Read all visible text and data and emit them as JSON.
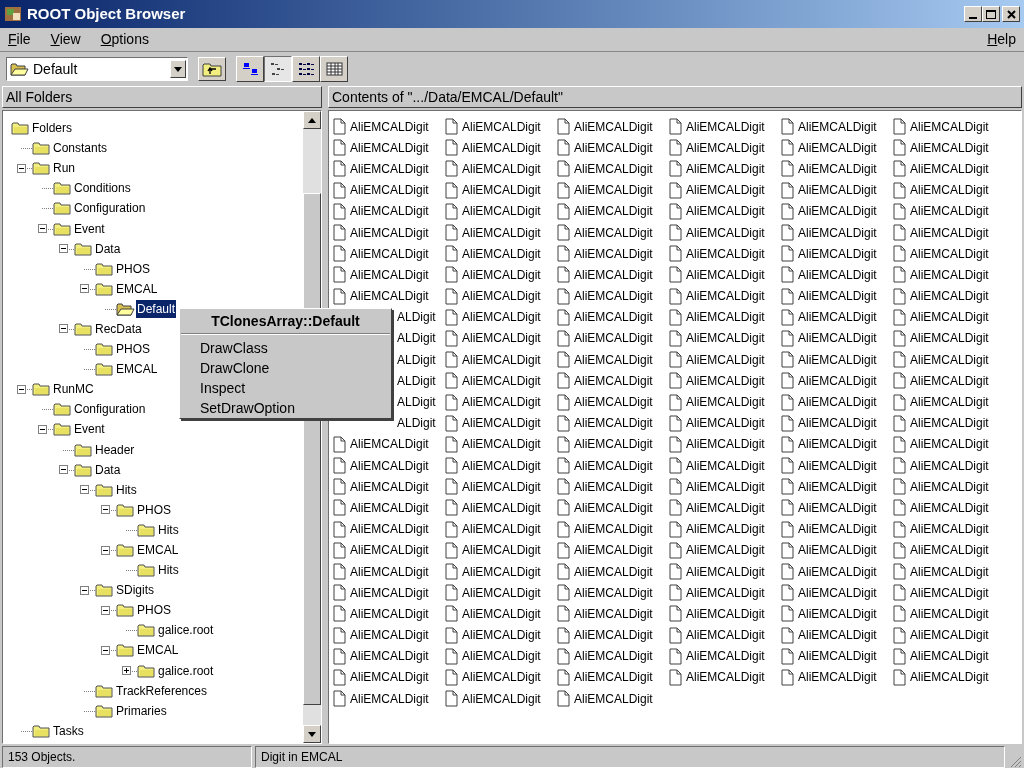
{
  "window": {
    "title": "ROOT Object Browser"
  },
  "menus": [
    {
      "label": "File"
    },
    {
      "label": "View"
    },
    {
      "label": "Options"
    }
  ],
  "help_menu": {
    "label": "Help"
  },
  "toolbar": {
    "location": "Default",
    "view_buttons": [
      {
        "kind": "large",
        "selected": false
      },
      {
        "kind": "list",
        "selected": true
      },
      {
        "kind": "small",
        "selected": false
      },
      {
        "kind": "details",
        "selected": false
      }
    ]
  },
  "left_pane": {
    "header": "All Folders",
    "tree": [
      {
        "label": "Folders",
        "selected": false,
        "children": [
          {
            "label": "Constants",
            "selected": false
          },
          {
            "label": "Run",
            "selected": false,
            "expanded": true,
            "children": [
              {
                "label": "Conditions",
                "selected": false
              },
              {
                "label": "Configuration",
                "selected": false
              },
              {
                "label": "Event",
                "selected": false,
                "expanded": true,
                "children": [
                  {
                    "label": "Data",
                    "selected": false,
                    "expanded": true,
                    "children": [
                      {
                        "label": "PHOS",
                        "selected": false
                      },
                      {
                        "label": "EMCAL",
                        "selected": false,
                        "expanded": true,
                        "children": [
                          {
                            "label": "Default",
                            "selected": true
                          }
                        ]
                      }
                    ]
                  },
                  {
                    "label": "RecData",
                    "selected": false,
                    "expanded": true,
                    "children": [
                      {
                        "label": "PHOS",
                        "selected": false
                      },
                      {
                        "label": "EMCAL",
                        "selected": false
                      }
                    ]
                  }
                ]
              }
            ]
          },
          {
            "label": "RunMC",
            "selected": false,
            "expanded": true,
            "children": [
              {
                "label": "Configuration",
                "selected": false
              },
              {
                "label": "Event",
                "selected": false,
                "expanded": true,
                "children": [
                  {
                    "label": "Header",
                    "selected": false
                  },
                  {
                    "label": "Data",
                    "selected": false,
                    "expanded": true,
                    "children": [
                      {
                        "label": "Hits",
                        "selected": false,
                        "expanded": true,
                        "children": [
                          {
                            "label": "PHOS",
                            "selected": false,
                            "expanded": true,
                            "children": [
                              {
                                "label": "Hits",
                                "selected": false
                              }
                            ]
                          },
                          {
                            "label": "EMCAL",
                            "selected": false,
                            "expanded": true,
                            "children": [
                              {
                                "label": "Hits",
                                "selected": false
                              }
                            ]
                          }
                        ]
                      },
                      {
                        "label": "SDigits",
                        "selected": false,
                        "expanded": true,
                        "children": [
                          {
                            "label": "PHOS",
                            "selected": false,
                            "expanded": true,
                            "children": [
                              {
                                "label": "galice.root",
                                "selected": false
                              }
                            ]
                          },
                          {
                            "label": "EMCAL",
                            "selected": false,
                            "expanded": true,
                            "children": [
                              {
                                "label": "galice.root",
                                "selected": false,
                                "expanded": false
                              }
                            ]
                          }
                        ]
                      },
                      {
                        "label": "TrackReferences",
                        "selected": false
                      },
                      {
                        "label": "Primaries",
                        "selected": false
                      }
                    ]
                  }
                ]
              }
            ]
          },
          {
            "label": "Tasks",
            "selected": false
          }
        ]
      }
    ]
  },
  "right_pane": {
    "header": "Contents of \".../Data/EMCAL/Default\"",
    "items": [
      {
        "kind": "file",
        "label": "AliEMCALDigit"
      },
      {
        "kind": "file",
        "label": "AliEMCALDigit"
      },
      {
        "kind": "file",
        "label": "AliEMCALDigit"
      },
      {
        "kind": "file",
        "label": "AliEMCALDigit"
      },
      {
        "kind": "file",
        "label": "AliEMCALDigit"
      },
      {
        "kind": "file",
        "label": "AliEMCALDigit"
      },
      {
        "kind": "file",
        "label": "AliEMCALDigit"
      },
      {
        "kind": "file",
        "label": "AliEMCALDigit"
      },
      {
        "kind": "file",
        "label": "AliEMCALDigit"
      },
      {
        "kind": "file",
        "label": "AliEMCALDigit"
      },
      {
        "kind": "file",
        "label": "AliEMCALDigit"
      },
      {
        "kind": "file",
        "label": "AliEMCALDigit"
      },
      {
        "kind": "file",
        "label": "AliEMCALDigit"
      },
      {
        "kind": "file",
        "label": "AliEMCALDigit"
      },
      {
        "kind": "file",
        "label": "AliEMCALDigit"
      },
      {
        "kind": "file",
        "label": "AliEMCALDigit"
      },
      {
        "kind": "file",
        "label": "AliEMCALDigit"
      },
      {
        "kind": "file",
        "label": "AliEMCALDigit"
      },
      {
        "kind": "file",
        "label": "AliEMCALDigit"
      },
      {
        "kind": "file",
        "label": "AliEMCALDigit"
      },
      {
        "kind": "file",
        "label": "AliEMCALDigit"
      },
      {
        "kind": "file",
        "label": "AliEMCALDigit"
      },
      {
        "kind": "file",
        "label": "AliEMCALDigit"
      },
      {
        "kind": "file",
        "label": "AliEMCALDigit"
      },
      {
        "kind": "file",
        "label": "AliEMCALDigit"
      },
      {
        "kind": "file",
        "label": "AliEMCALDigit"
      },
      {
        "kind": "file",
        "label": "AliEMCALDigit"
      },
      {
        "kind": "file",
        "label": "AliEMCALDigit"
      },
      {
        "kind": "file",
        "label": "AliEMCALDigit"
      },
      {
        "kind": "file",
        "label": "AliEMCALDigit"
      },
      {
        "kind": "file",
        "label": "AliEMCALDigit"
      },
      {
        "kind": "file",
        "label": "AliEMCALDigit"
      },
      {
        "kind": "file",
        "label": "AliEMCALDigit"
      },
      {
        "kind": "file",
        "label": "AliEMCALDigit"
      },
      {
        "kind": "file",
        "label": "AliEMCALDigit"
      },
      {
        "kind": "file",
        "label": "AliEMCALDigit"
      },
      {
        "kind": "file",
        "label": "AliEMCALDigit"
      },
      {
        "kind": "file",
        "label": "AliEMCALDigit"
      },
      {
        "kind": "file",
        "label": "AliEMCALDigit"
      },
      {
        "kind": "file",
        "label": "AliEMCALDigit"
      },
      {
        "kind": "file",
        "label": "AliEMCALDigit"
      },
      {
        "kind": "file",
        "label": "AliEMCALDigit"
      },
      {
        "kind": "file",
        "label": "AliEMCALDigit"
      },
      {
        "kind": "file",
        "label": "AliEMCALDigit"
      },
      {
        "kind": "file",
        "label": "AliEMCALDigit"
      },
      {
        "kind": "file",
        "label": "AliEMCALDigit"
      },
      {
        "kind": "file",
        "label": "AliEMCALDigit"
      },
      {
        "kind": "file",
        "label": "AliEMCALDigit"
      },
      {
        "kind": "file",
        "label": "AliEMCALDigit"
      },
      {
        "kind": "file",
        "label": "AliEMCALDigit"
      },
      {
        "kind": "file",
        "label": "AliEMCALDigit"
      },
      {
        "kind": "file",
        "label": "AliEMCALDigit"
      },
      {
        "kind": "file",
        "label": "AliEMCALDigit"
      },
      {
        "kind": "file",
        "label": "AliEMCALDigit"
      },
      {
        "kind": "covered",
        "label": "ALDigit"
      },
      {
        "kind": "file",
        "label": "AliEMCALDigit"
      },
      {
        "kind": "file",
        "label": "AliEMCALDigit"
      },
      {
        "kind": "file",
        "label": "AliEMCALDigit"
      },
      {
        "kind": "file",
        "label": "AliEMCALDigit"
      },
      {
        "kind": "file",
        "label": "AliEMCALDigit"
      },
      {
        "kind": "covered",
        "label": "ALDigit"
      },
      {
        "kind": "file",
        "label": "AliEMCALDigit"
      },
      {
        "kind": "file",
        "label": "AliEMCALDigit"
      },
      {
        "kind": "file",
        "label": "AliEMCALDigit"
      },
      {
        "kind": "file",
        "label": "AliEMCALDigit"
      },
      {
        "kind": "file",
        "label": "AliEMCALDigit"
      },
      {
        "kind": "covered",
        "label": "ALDigit"
      },
      {
        "kind": "file",
        "label": "AliEMCALDigit"
      },
      {
        "kind": "file",
        "label": "AliEMCALDigit"
      },
      {
        "kind": "file",
        "label": "AliEMCALDigit"
      },
      {
        "kind": "file",
        "label": "AliEMCALDigit"
      },
      {
        "kind": "file",
        "label": "AliEMCALDigit"
      },
      {
        "kind": "covered",
        "label": "ALDigit"
      },
      {
        "kind": "file",
        "label": "AliEMCALDigit"
      },
      {
        "kind": "file",
        "label": "AliEMCALDigit"
      },
      {
        "kind": "file",
        "label": "AliEMCALDigit"
      },
      {
        "kind": "file",
        "label": "AliEMCALDigit"
      },
      {
        "kind": "file",
        "label": "AliEMCALDigit"
      },
      {
        "kind": "covered",
        "label": "ALDigit"
      },
      {
        "kind": "file",
        "label": "AliEMCALDigit"
      },
      {
        "kind": "file",
        "label": "AliEMCALDigit"
      },
      {
        "kind": "file",
        "label": "AliEMCALDigit"
      },
      {
        "kind": "file",
        "label": "AliEMCALDigit"
      },
      {
        "kind": "file",
        "label": "AliEMCALDigit"
      },
      {
        "kind": "covered",
        "label": "ALDigit"
      },
      {
        "kind": "file",
        "label": "AliEMCALDigit"
      },
      {
        "kind": "file",
        "label": "AliEMCALDigit"
      },
      {
        "kind": "file",
        "label": "AliEMCALDigit"
      },
      {
        "kind": "file",
        "label": "AliEMCALDigit"
      },
      {
        "kind": "file",
        "label": "AliEMCALDigit"
      },
      {
        "kind": "file",
        "label": "AliEMCALDigit"
      },
      {
        "kind": "file",
        "label": "AliEMCALDigit"
      },
      {
        "kind": "file",
        "label": "AliEMCALDigit"
      },
      {
        "kind": "file",
        "label": "AliEMCALDigit"
      },
      {
        "kind": "file",
        "label": "AliEMCALDigit"
      },
      {
        "kind": "file",
        "label": "AliEMCALDigit"
      },
      {
        "kind": "file",
        "label": "AliEMCALDigit"
      },
      {
        "kind": "file",
        "label": "AliEMCALDigit"
      },
      {
        "kind": "file",
        "label": "AliEMCALDigit"
      },
      {
        "kind": "file",
        "label": "AliEMCALDigit"
      },
      {
        "kind": "file",
        "label": "AliEMCALDigit"
      },
      {
        "kind": "file",
        "label": "AliEMCALDigit"
      },
      {
        "kind": "file",
        "label": "AliEMCALDigit"
      },
      {
        "kind": "file",
        "label": "AliEMCALDigit"
      },
      {
        "kind": "file",
        "label": "AliEMCALDigit"
      },
      {
        "kind": "file",
        "label": "AliEMCALDigit"
      },
      {
        "kind": "file",
        "label": "AliEMCALDigit"
      },
      {
        "kind": "file",
        "label": "AliEMCALDigit"
      },
      {
        "kind": "file",
        "label": "AliEMCALDigit"
      },
      {
        "kind": "file",
        "label": "AliEMCALDigit"
      },
      {
        "kind": "file",
        "label": "AliEMCALDigit"
      },
      {
        "kind": "file",
        "label": "AliEMCALDigit"
      },
      {
        "kind": "file",
        "label": "AliEMCALDigit"
      },
      {
        "kind": "file",
        "label": "AliEMCALDigit"
      },
      {
        "kind": "file",
        "label": "AliEMCALDigit"
      },
      {
        "kind": "file",
        "label": "AliEMCALDigit"
      },
      {
        "kind": "file",
        "label": "AliEMCALDigit"
      },
      {
        "kind": "file",
        "label": "AliEMCALDigit"
      },
      {
        "kind": "file",
        "label": "AliEMCALDigit"
      },
      {
        "kind": "file",
        "label": "AliEMCALDigit"
      },
      {
        "kind": "file",
        "label": "AliEMCALDigit"
      },
      {
        "kind": "file",
        "label": "AliEMCALDigit"
      },
      {
        "kind": "file",
        "label": "AliEMCALDigit"
      },
      {
        "kind": "file",
        "label": "AliEMCALDigit"
      },
      {
        "kind": "file",
        "label": "AliEMCALDigit"
      },
      {
        "kind": "file",
        "label": "AliEMCALDigit"
      },
      {
        "kind": "file",
        "label": "AliEMCALDigit"
      },
      {
        "kind": "file",
        "label": "AliEMCALDigit"
      },
      {
        "kind": "file",
        "label": "AliEMCALDigit"
      },
      {
        "kind": "file",
        "label": "AliEMCALDigit"
      },
      {
        "kind": "file",
        "label": "AliEMCALDigit"
      },
      {
        "kind": "file",
        "label": "AliEMCALDigit"
      },
      {
        "kind": "file",
        "label": "AliEMCALDigit"
      },
      {
        "kind": "file",
        "label": "AliEMCALDigit"
      },
      {
        "kind": "file",
        "label": "AliEMCALDigit"
      },
      {
        "kind": "file",
        "label": "AliEMCALDigit"
      },
      {
        "kind": "file",
        "label": "AliEMCALDigit"
      },
      {
        "kind": "file",
        "label": "AliEMCALDigit"
      },
      {
        "kind": "file",
        "label": "AliEMCALDigit"
      },
      {
        "kind": "file",
        "label": "AliEMCALDigit"
      },
      {
        "kind": "file",
        "label": "AliEMCALDigit"
      },
      {
        "kind": "file",
        "label": "AliEMCALDigit"
      },
      {
        "kind": "file",
        "label": "AliEMCALDigit"
      },
      {
        "kind": "file",
        "label": "AliEMCALDigit"
      },
      {
        "kind": "file",
        "label": "AliEMCALDigit"
      },
      {
        "kind": "file",
        "label": "AliEMCALDigit"
      },
      {
        "kind": "file",
        "label": "AliEMCALDigit"
      },
      {
        "kind": "file",
        "label": "AliEMCALDigit"
      },
      {
        "kind": "file",
        "label": "AliEMCALDigit"
      },
      {
        "kind": "file",
        "label": "AliEMCALDigit"
      },
      {
        "kind": "file",
        "label": "AliEMCALDigit"
      },
      {
        "kind": "file",
        "label": "AliEMCALDigit"
      },
      {
        "kind": "file",
        "label": "AliEMCALDigit"
      },
      {
        "kind": "file",
        "label": "AliEMCALDigit"
      },
      {
        "kind": "file",
        "label": "AliEMCALDigit"
      },
      {
        "kind": "file",
        "label": "AliEMCALDigit"
      },
      {
        "kind": "file",
        "label": "AliEMCALDigit"
      },
      {
        "kind": "file",
        "label": "AliEMCALDigit"
      },
      {
        "kind": "file",
        "label": "AliEMCALDigit"
      },
      {
        "kind": "file",
        "label": "AliEMCALDigit"
      },
      {
        "kind": "file",
        "label": "AliEMCALDigit"
      },
      {
        "kind": "file",
        "label": "AliEMCALDigit"
      },
      {
        "kind": "file",
        "label": "AliEMCALDigit"
      },
      {
        "kind": "file",
        "label": "AliEMCALDigit"
      },
      {
        "kind": "file",
        "label": "AliEMCALDigit"
      }
    ]
  },
  "context_menu": {
    "title": "TClonesArray::Default",
    "items": [
      {
        "label": "DrawClass"
      },
      {
        "label": "DrawClone"
      },
      {
        "label": "Inspect"
      },
      {
        "label": "SetDrawOption"
      }
    ]
  },
  "status_bar": [
    {
      "text": "153 Objects."
    },
    {
      "text": "Digit in EMCAL"
    }
  ]
}
